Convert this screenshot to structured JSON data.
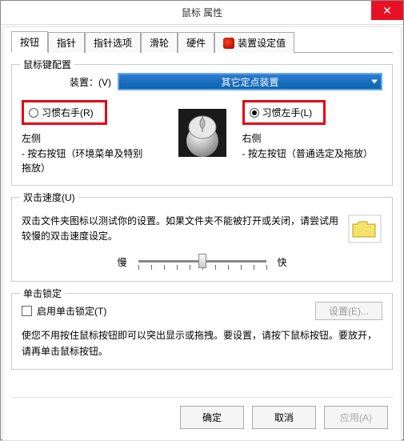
{
  "window": {
    "title": "鼠标 属性"
  },
  "tabs": {
    "buttons": "按钮",
    "pointer": "指针",
    "pointer_options": "指针选项",
    "wheel": "滑轮",
    "hardware": "硬件",
    "device_settings": "装置设定值"
  },
  "button_config": {
    "legend": "鼠标键配置",
    "device_label": "装置：(V)",
    "device_select_value": "其它定点装置",
    "right_hand_label": "习惯右手(R)",
    "left_hand_label": "习惯左手(L)",
    "selected": "left",
    "left_side_label": "左侧",
    "left_side_desc": "- 按右按钮（环境菜单及特别拖放）",
    "right_side_label": "右侧",
    "right_side_desc": "- 按左按钮（普通选定及拖放）"
  },
  "double_click": {
    "legend": "双击速度(U)",
    "desc": "双击文件夹图标以测试你的设置。如果文件夹不能被打开或关闭，请尝试用较慢的双击速度设定。",
    "slow_label": "慢",
    "fast_label": "快"
  },
  "click_lock": {
    "legend": "单击锁定",
    "checkbox_label": "启用单击锁定(T)",
    "settings_button": "设置(E)...",
    "desc": "使您不用按住鼠标按钮即可以突出显示或拖拽。要设置，请按下鼠标按钮。要放开，请再单击鼠标按钮。"
  },
  "footer": {
    "ok": "确定",
    "cancel": "取消",
    "apply": "应用(A)"
  }
}
